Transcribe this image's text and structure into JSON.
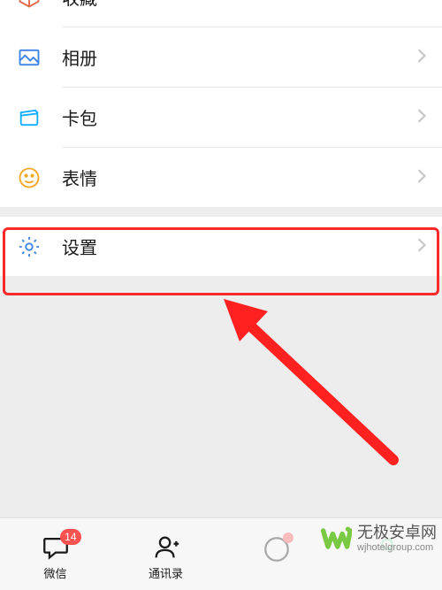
{
  "menu": {
    "favorites": {
      "label": "收藏"
    },
    "album": {
      "label": "相册"
    },
    "wallet": {
      "label": "卡包"
    },
    "stickers": {
      "label": "表情"
    },
    "settings": {
      "label": "设置"
    }
  },
  "tabs": {
    "chats": {
      "label": "微信",
      "badge": "14"
    },
    "contacts": {
      "label": "通讯录"
    }
  },
  "watermark": {
    "name": "无极安卓网",
    "url": "wjhotelgroup.com"
  },
  "colors": {
    "highlight": "#fa2a2a",
    "badge": "#fa5151",
    "icon_blue": "#3d83e6",
    "icon_teal": "#10aeff",
    "icon_green": "#5ac45a",
    "icon_orange": "#f5a623",
    "icon_settings": "#3d83e6"
  }
}
